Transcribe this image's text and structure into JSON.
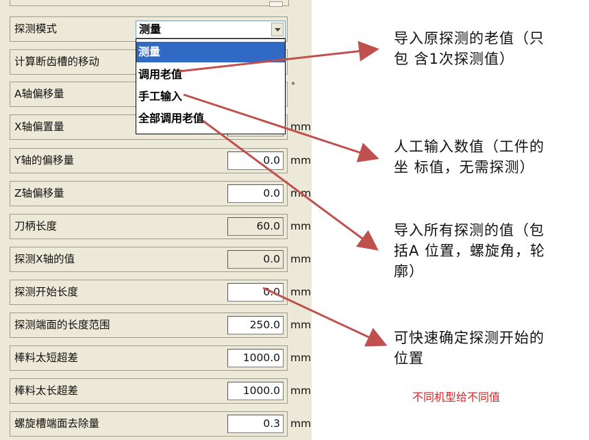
{
  "panel": {
    "rows": [
      {
        "label": "探测模式"
      },
      {
        "label": "计算断齿槽的移动"
      },
      {
        "label": "A轴偏移量",
        "unit": "°"
      },
      {
        "label": "X轴偏置量",
        "unit": "mm"
      },
      {
        "label": "Y轴的偏移量",
        "value": "0.0",
        "unit": "mm"
      },
      {
        "label": "Z轴偏移量",
        "value": "0.0",
        "unit": "mm"
      },
      {
        "label": "刀柄长度",
        "value": "60.0",
        "unit": "mm",
        "readonly": true
      },
      {
        "label": "探测X轴的值",
        "value": "0.0",
        "unit": "mm",
        "readonly": true
      },
      {
        "label": "探测开始长度",
        "value": "0.0",
        "unit": "mm"
      },
      {
        "label": "探测端面的长度范围",
        "value": "250.0",
        "unit": "mm"
      },
      {
        "label": "棒料太短超差",
        "value": "1000.0",
        "unit": "mm"
      },
      {
        "label": "棒料太长超差",
        "value": "1000.0",
        "unit": "mm"
      },
      {
        "label": "螺旋槽端面去除量",
        "value": "0.3",
        "unit": "mm"
      }
    ],
    "combo": {
      "value": "测量",
      "options": [
        "测量",
        "调用老值",
        "手工输入",
        "全部调用老值"
      ],
      "selected_index": 0
    }
  },
  "annotations": [
    {
      "lines": [
        "导入原探测的老值（只",
        "包 含1次探测值）"
      ]
    },
    {
      "lines": [
        "人工输入数值（工件的",
        "坐 标值，无需探测）"
      ]
    },
    {
      "lines": [
        "导入所有探测的值（包",
        "括A 位置，螺旋角，轮",
        "廓）"
      ]
    },
    {
      "lines": [
        "可快速确定探测开始的",
        "位置"
      ]
    }
  ],
  "footnote": "不同机型给不同值",
  "colors": {
    "arrow": "#c0504d",
    "selection": "#316ac5",
    "panel": "#ece9d8",
    "footnote": "#e02020"
  }
}
